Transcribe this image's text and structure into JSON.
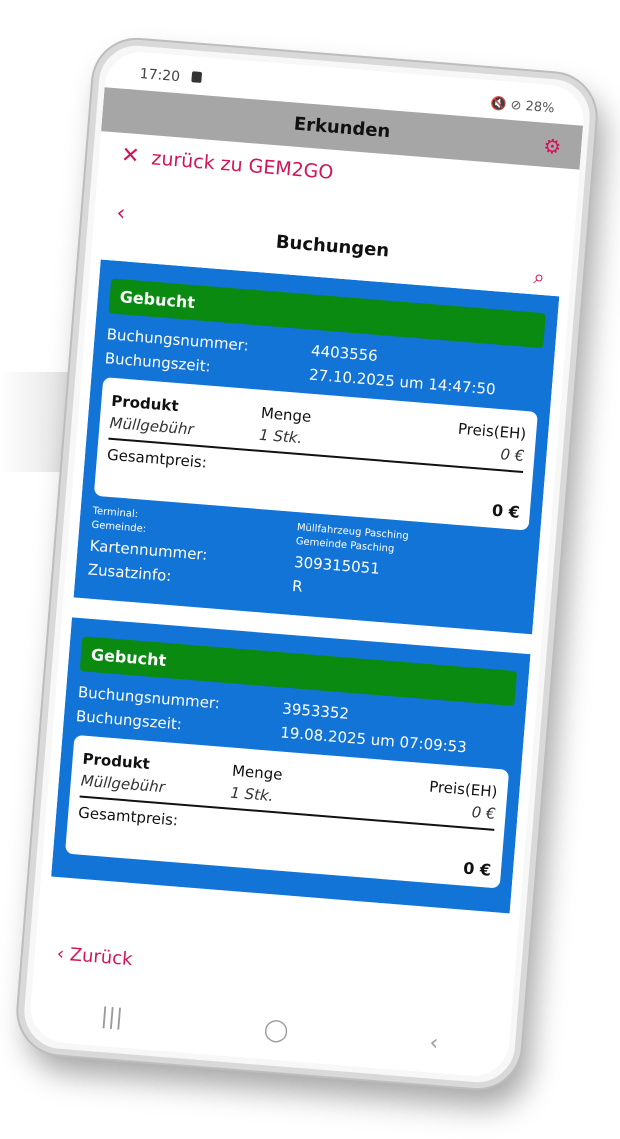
{
  "status_bar": {
    "time": "17:20",
    "right": "🔇  ⊘ 28%"
  },
  "app_bar": {
    "title": "Erkunden"
  },
  "nav": {
    "back_to_app": "zurück zu GEM2GO",
    "back_symbol": "‹",
    "page_title": "Buchungen",
    "bottom_back": "Zurück"
  },
  "icons": {
    "gear": "gear-icon",
    "search": "search-icon",
    "close": "close-icon",
    "back": "chevron-left-icon"
  },
  "colors": {
    "accent": "#d2145a",
    "card": "#1274d6",
    "booked": "#0b8a12",
    "appbar": "#a6a6a6"
  },
  "bookings": [
    {
      "status": "Gebucht",
      "number_label": "Buchungsnummer:",
      "number": "4403556",
      "time_label": "Buchungszeit:",
      "time": "27.10.2025 um 14:47:50",
      "table": {
        "headers": [
          "Produkt",
          "Menge",
          "Preis(EH)"
        ],
        "rows": [
          {
            "product": "Müllgebühr",
            "qty": "1 Stk.",
            "price": "0 €"
          }
        ],
        "total_label": "Gesamtpreis:",
        "total": "0 €"
      },
      "terminal_label": "Terminal:",
      "terminal": "Müllfahrzeug Pasching",
      "community_label": "Gemeinde:",
      "community": "Gemeinde Pasching",
      "card_label": "Kartennummer:",
      "card_number": "309315051",
      "extra_label": "Zusatzinfo:",
      "extra": "R"
    },
    {
      "status": "Gebucht",
      "number_label": "Buchungsnummer:",
      "number": "3953352",
      "time_label": "Buchungszeit:",
      "time": "19.08.2025 um 07:09:53",
      "table": {
        "headers": [
          "Produkt",
          "Menge",
          "Preis(EH)"
        ],
        "rows": [
          {
            "product": "Müllgebühr",
            "qty": "1 Stk.",
            "price": "0 €"
          }
        ],
        "total_label": "Gesamtpreis:",
        "total": "0 €"
      }
    }
  ],
  "system_nav": {
    "recents": "|||",
    "home": "◯",
    "back": "‹"
  }
}
